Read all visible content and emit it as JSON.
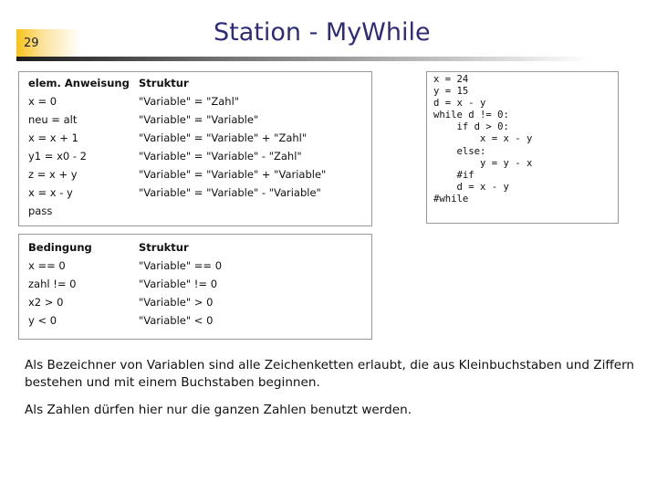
{
  "slide": {
    "number": "29",
    "title": "Station - MyWhile"
  },
  "statements_table": {
    "headers": [
      "elem. Anweisung",
      "Struktur"
    ],
    "rows": [
      [
        "x = 0",
        "\"Variable\" = \"Zahl\""
      ],
      [
        "neu = alt",
        "\"Variable\" = \"Variable\""
      ],
      [
        "x = x + 1",
        "\"Variable\" = \"Variable\" + \"Zahl\""
      ],
      [
        "y1 = x0 - 2",
        "\"Variable\" = \"Variable\" - \"Zahl\""
      ],
      [
        "z = x + y",
        "\"Variable\" = \"Variable\" + \"Variable\""
      ],
      [
        "x = x - y",
        "\"Variable\" = \"Variable\" - \"Variable\""
      ],
      [
        "pass",
        ""
      ]
    ]
  },
  "conditions_table": {
    "headers": [
      "Bedingung",
      "Struktur"
    ],
    "rows": [
      [
        "x == 0",
        "\"Variable\" == 0"
      ],
      [
        "zahl != 0",
        "\"Variable\" != 0"
      ],
      [
        "x2 > 0",
        "\"Variable\" > 0"
      ],
      [
        "y < 0",
        "\"Variable\" < 0"
      ]
    ]
  },
  "code_example": "x = 24\ny = 15\nd = x - y\nwhile d != 0:\n    if d > 0:\n        x = x - y\n    else:\n        y = y - x\n    #if\n    d = x - y\n#while",
  "paragraphs": [
    "Als Bezeichner von Variablen sind alle Zeichenketten erlaubt, die aus Kleinbuchstaben und Ziffern bestehen und mit einem Buchstaben beginnen.",
    "Als Zahlen dürfen hier nur die ganzen Zahlen benutzt werden."
  ],
  "colors": {
    "title": "#2e2c7a",
    "number_accent": "#f6c21a",
    "box_border": "#999999"
  }
}
